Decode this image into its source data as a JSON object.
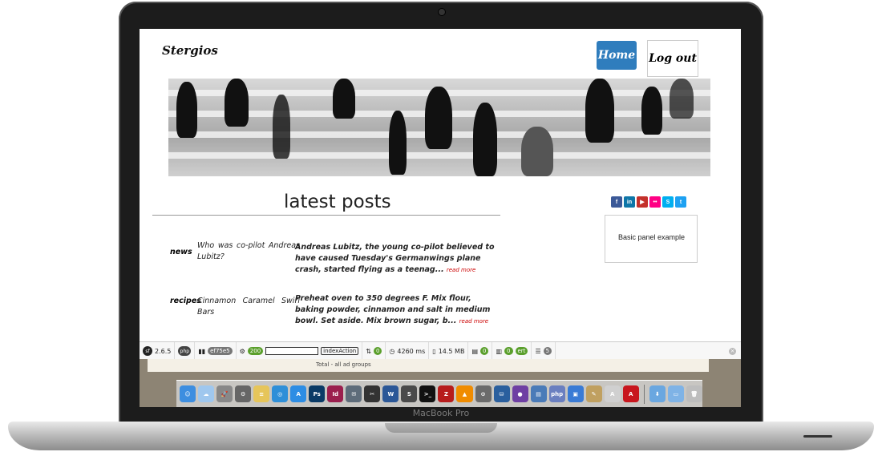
{
  "device": {
    "brand_label": "MacBook Pro"
  },
  "site": {
    "title": "Stergios"
  },
  "nav": {
    "home": "Home",
    "logout": "Log out"
  },
  "main": {
    "heading": "latest posts"
  },
  "posts": [
    {
      "category": "news",
      "title": "Who was co-pilot Andreas Lubitz?",
      "excerpt": "Andreas Lubitz, the young co-pilot believed to have caused Tuesday's Germanwings plane crash, started flying as a teenag...",
      "more": "read more"
    },
    {
      "category": "recipes",
      "title": "Cinnamon Caramel Swirl Bars",
      "excerpt": "Preheat oven to 350 degrees F. Mix flour, baking powder, cinnamon and salt in medium bowl. Set aside. Mix brown sugar, b...",
      "more": "read more"
    }
  ],
  "sidebar": {
    "panel_text": "Basic panel example",
    "social": [
      {
        "icon": "facebook-icon",
        "glyph": "f",
        "color": "#3b5998"
      },
      {
        "icon": "linkedin-icon",
        "glyph": "in",
        "color": "#0e76a8"
      },
      {
        "icon": "youtube-icon",
        "glyph": "▶",
        "color": "#c4302b"
      },
      {
        "icon": "flickr-icon",
        "glyph": "••",
        "color": "#ff0084"
      },
      {
        "icon": "skype-icon",
        "glyph": "S",
        "color": "#00aff0"
      },
      {
        "icon": "twitter-icon",
        "glyph": "t",
        "color": "#1da1f2"
      }
    ]
  },
  "debug_toolbar": {
    "version": "2.6.5",
    "php": "php",
    "token": "ef75e5",
    "status": "200",
    "action": "indexAction",
    "requests": "0",
    "time": "4260 ms",
    "memory": "14.5 MB",
    "forms": "0",
    "translations": "0",
    "security": "ert",
    "events": "5"
  },
  "background_sheet": {
    "text": "Total - all ad groups"
  },
  "dock_apps": [
    {
      "name": "finder-icon",
      "glyph": "☺",
      "color": "#3d8ee0"
    },
    {
      "name": "icloud-icon",
      "glyph": "☁",
      "color": "#9fc7ee"
    },
    {
      "name": "launchpad-icon",
      "glyph": "🚀",
      "color": "#888"
    },
    {
      "name": "system-prefs-icon",
      "glyph": "⚙",
      "color": "#666"
    },
    {
      "name": "notes-icon",
      "glyph": "≡",
      "color": "#e6c55a"
    },
    {
      "name": "safari-icon",
      "glyph": "◎",
      "color": "#2f8fd8"
    },
    {
      "name": "app-store-icon",
      "glyph": "A",
      "color": "#2d8de4"
    },
    {
      "name": "photoshop-icon",
      "glyph": "Ps",
      "color": "#0a3a66"
    },
    {
      "name": "indesign-icon",
      "glyph": "Id",
      "color": "#9b1f4e"
    },
    {
      "name": "mail-icon",
      "glyph": "✉",
      "color": "#5e6c7a"
    },
    {
      "name": "final-cut-icon",
      "glyph": "✂",
      "color": "#333"
    },
    {
      "name": "word-icon",
      "glyph": "W",
      "color": "#2b5797"
    },
    {
      "name": "sublime-icon",
      "glyph": "S",
      "color": "#4a4a4a"
    },
    {
      "name": "terminal-icon",
      "glyph": ">_",
      "color": "#111"
    },
    {
      "name": "filezilla-icon",
      "glyph": "Z",
      "color": "#b71c1c"
    },
    {
      "name": "vlc-icon",
      "glyph": "▲",
      "color": "#f08c00"
    },
    {
      "name": "transmission-icon",
      "glyph": "⊙",
      "color": "#6b6b6b"
    },
    {
      "name": "mysql-workbench-icon",
      "glyph": "⛁",
      "color": "#2a5f9e"
    },
    {
      "name": "github-icon",
      "glyph": "●",
      "color": "#6e3fa3"
    },
    {
      "name": "sequel-pro-icon",
      "glyph": "▤",
      "color": "#4a7bb8"
    },
    {
      "name": "php-storm-icon",
      "glyph": "php",
      "color": "#6a7fc0"
    },
    {
      "name": "preview-icon",
      "glyph": "▣",
      "color": "#3a7bd5"
    },
    {
      "name": "pencil-icon",
      "glyph": "✎",
      "color": "#c0a060"
    },
    {
      "name": "acrobat-icon",
      "glyph": "A",
      "color": "#d0d0d0"
    },
    {
      "name": "acrobat-pro-icon",
      "glyph": "A",
      "color": "#c8161d"
    },
    {
      "name": "downloads-icon",
      "glyph": "⬇",
      "color": "#6aa7e0"
    },
    {
      "name": "documents-icon",
      "glyph": "▭",
      "color": "#7fb3e6"
    },
    {
      "name": "trash-icon",
      "glyph": "🗑",
      "color": "#bdbdbd"
    }
  ]
}
